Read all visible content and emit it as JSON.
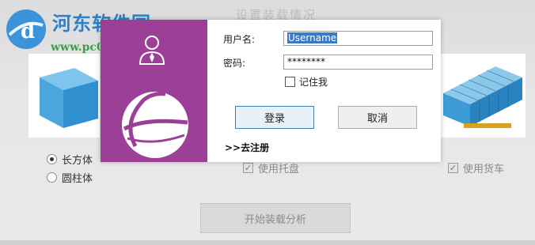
{
  "watermark": {
    "logo_glyph": "d",
    "title": "河东软件园",
    "url": "www.pc0359.cn"
  },
  "background": {
    "heading": "设置装载情况",
    "shape_options": [
      {
        "label": "长方体",
        "selected": true
      },
      {
        "label": "圆柱体",
        "selected": false
      }
    ],
    "use_pallet_label": "使用托盘",
    "use_pallet_checked": true,
    "use_truck_label": "使用货车",
    "use_truck_checked": true,
    "start_button_label": "开始装载分析"
  },
  "login": {
    "username_label": "用户名:",
    "username_value": "Username",
    "password_label": "密码:",
    "password_value": "********",
    "remember_label": "记住我",
    "remember_checked": false,
    "login_button": "登录",
    "cancel_button": "取消",
    "register_link": ">>去注册",
    "accent_color": "#9c3f97"
  },
  "icons": [
    "user-icon",
    "globe-logo-icon",
    "cube-icon",
    "container-truck-icon",
    "check-icon"
  ]
}
